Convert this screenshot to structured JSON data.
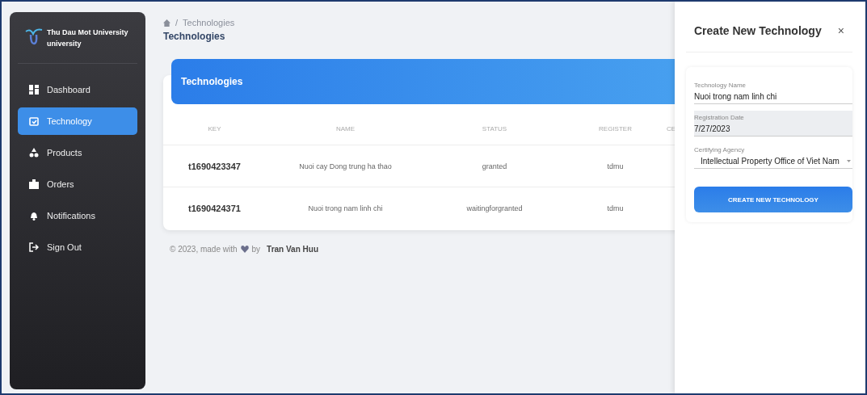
{
  "brand": {
    "title": "Thu Dau Mot University",
    "subtitle": "university"
  },
  "sidebar": {
    "items": [
      {
        "label": "Dashboard",
        "selected": false
      },
      {
        "label": "Technology",
        "selected": true
      },
      {
        "label": "Products",
        "selected": false
      },
      {
        "label": "Orders",
        "selected": false
      },
      {
        "label": "Notifications",
        "selected": false
      },
      {
        "label": "Sign Out",
        "selected": false
      }
    ]
  },
  "breadcrumb": {
    "separator": "/",
    "current": "Technologies",
    "title": "Technologies"
  },
  "table": {
    "title": "Technologies",
    "columns": [
      "KEY",
      "NAME",
      "STATUS",
      "REGISTER",
      "CE"
    ],
    "rows": [
      [
        "t1690423347",
        "Nuoi cay Dong trung ha thao",
        "granted",
        "tdmu"
      ],
      [
        "t1690424371",
        "Nuoi trong nam linh chi",
        "waitingforgranted",
        "tdmu"
      ]
    ]
  },
  "footer": {
    "prefix": "© 2023, made with",
    "by": "by",
    "author": "Tran Van Huu"
  },
  "drawer": {
    "title": "Create New Technology",
    "close": "×",
    "fields": [
      {
        "label": "Technology Name",
        "value": "Nuoi trong nam linh chi",
        "kind": "text",
        "disabled": false
      },
      {
        "label": "Registration Date",
        "value": "7/27/2023",
        "kind": "text",
        "disabled": true
      },
      {
        "label": "Certifying Agency",
        "value": "Intellectual Property Office of Viet Nam",
        "kind": "select",
        "disabled": false
      }
    ],
    "submit": "CREATE NEW TECHNOLOGY"
  }
}
